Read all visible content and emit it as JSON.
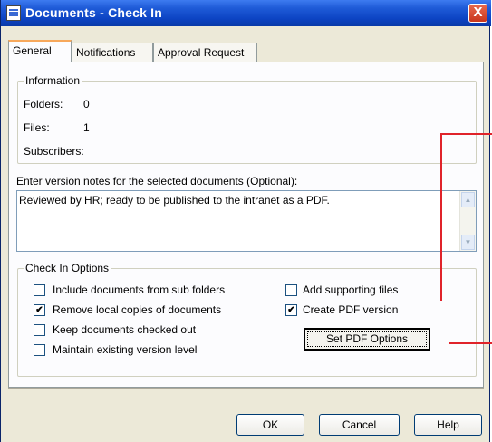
{
  "window": {
    "title": "Documents - Check In",
    "close_label": "X"
  },
  "tabs": [
    {
      "label": "General"
    },
    {
      "label": "Notifications"
    },
    {
      "label": "Approval Request"
    }
  ],
  "information": {
    "legend": "Information",
    "folders_label": "Folders:",
    "folders_value": "0",
    "files_label": "Files:",
    "files_value": "1",
    "subscribers_label": "Subscribers:"
  },
  "notes": {
    "label": "Enter version notes for the selected documents (Optional):",
    "value": "Reviewed by HR; ready to be published to the intranet as a PDF."
  },
  "options": {
    "legend": "Check In Options",
    "include_subfolders": {
      "label": "Include documents from sub folders",
      "checked": false
    },
    "remove_local": {
      "label": "Remove local copies of documents",
      "checked": true
    },
    "keep_checked_out": {
      "label": "Keep documents checked out",
      "checked": false
    },
    "maintain_version": {
      "label": "Maintain existing version level",
      "checked": false
    },
    "add_supporting": {
      "label": "Add supporting files",
      "checked": false
    },
    "create_pdf": {
      "label": "Create PDF version",
      "checked": true
    },
    "set_pdf_button": "Set PDF Options"
  },
  "footer": {
    "ok": "OK",
    "cancel": "Cancel",
    "help": "Help"
  },
  "colors": {
    "titlebar": "#0d44c4",
    "annotation": "#e0232a",
    "dialog_bg": "#ece9d8"
  }
}
